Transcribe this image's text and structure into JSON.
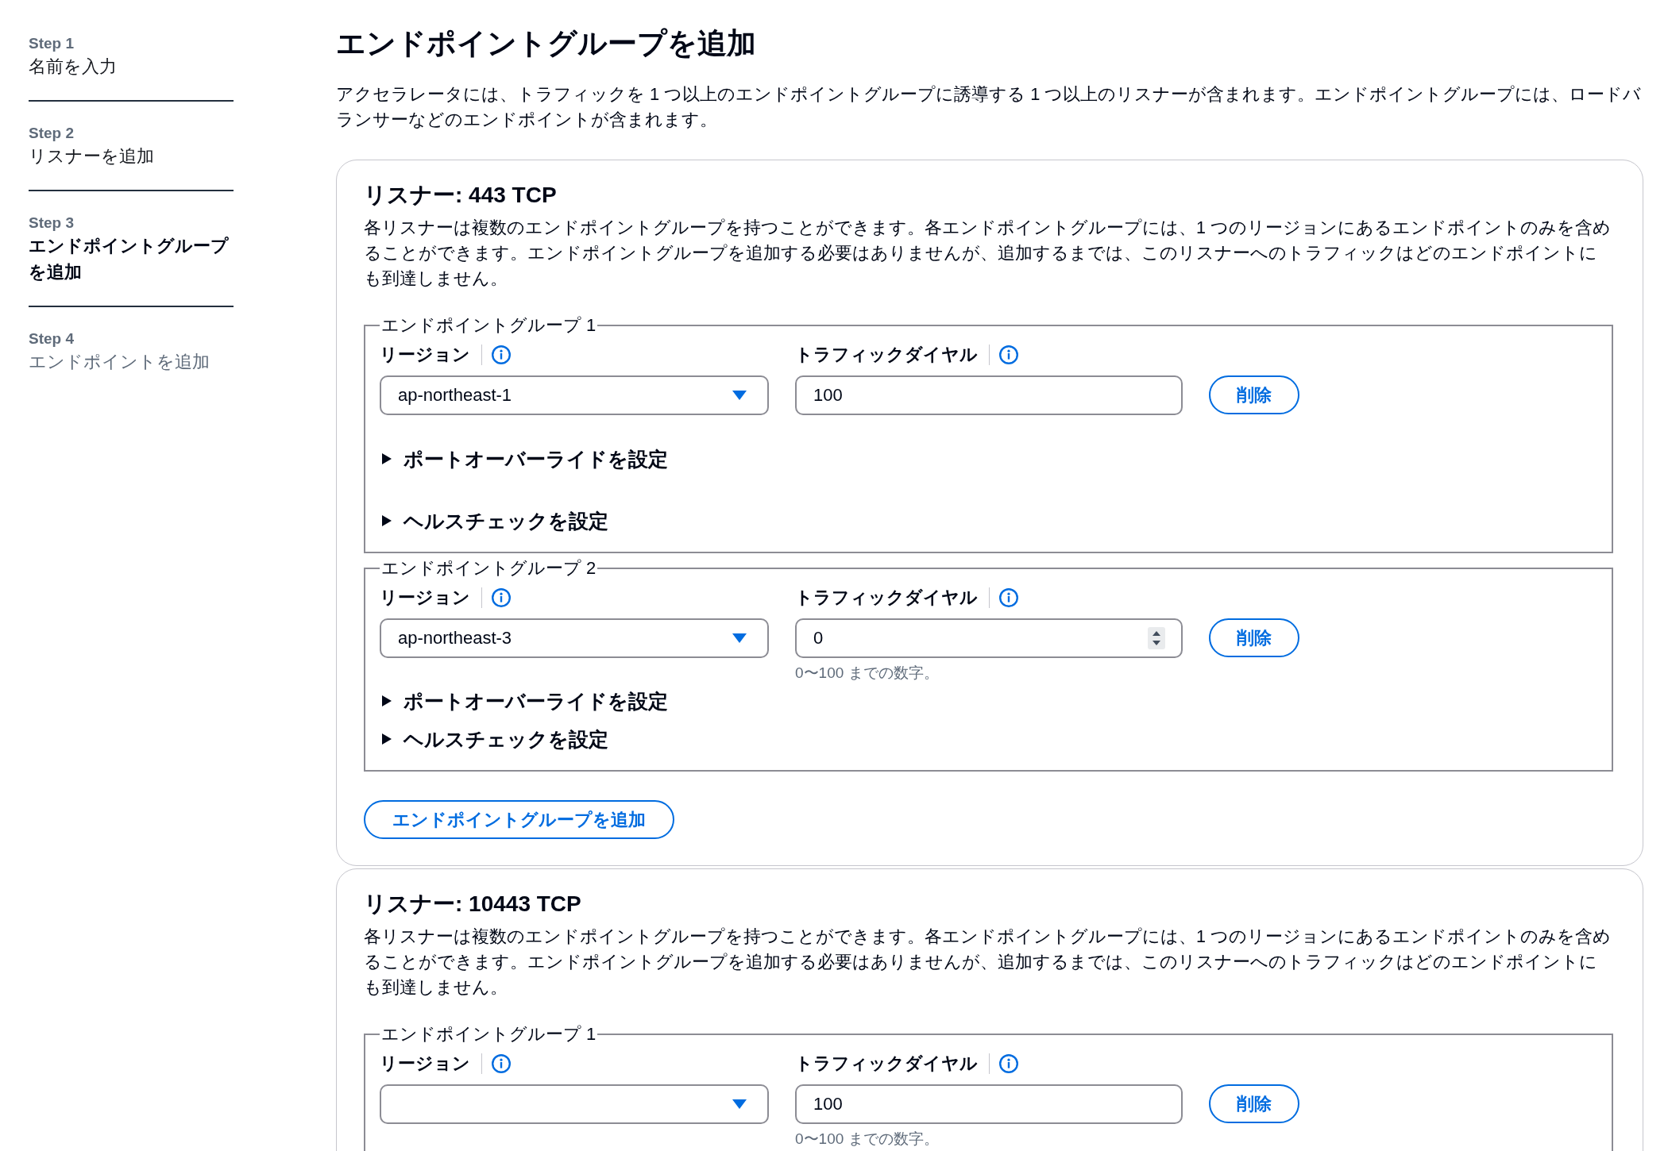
{
  "wizard_steps": [
    {
      "step": "Step 1",
      "label": "名前を入力",
      "selected": false,
      "disabled": false
    },
    {
      "step": "Step 2",
      "label": "リスナーを追加",
      "selected": false,
      "disabled": false
    },
    {
      "step": "Step 3",
      "label": "エンドポイントグループを追加",
      "selected": true,
      "disabled": false
    },
    {
      "step": "Step 4",
      "label": "エンドポイントを追加",
      "selected": false,
      "disabled": true
    }
  ],
  "page": {
    "title": "エンドポイントグループを追加",
    "description": "アクセラレータには、トラフィックを 1 つ以上のエンドポイントグループに誘導する 1 つ以上のリスナーが含まれます。エンドポイントグループには、ロードバランサーなどのエンドポイントが含まれます。"
  },
  "listeners": [
    {
      "title": "リスナー: 443 TCP",
      "description": "各リスナーは複数のエンドポイントグループを持つことができます。各エンドポイントグループには、1 つのリージョンにあるエンドポイントのみを含めることができます。エンドポイントグループを追加する必要はありませんが、追加するまでは、このリスナーへのトラフィックはどのエンドポイントにも到達しません。",
      "endpoint_groups": [
        {
          "legend": "エンドポイントグループ 1",
          "region": {
            "label": "リージョン",
            "value": "ap-northeast-1"
          },
          "traffic_dial": {
            "label": "トラフィックダイヤル",
            "value": "100",
            "spinner_visible": false
          },
          "remove_button": "削除",
          "expanders": [
            {
              "label": "ポートオーバーライドを設定",
              "expanded": false
            },
            {
              "label": "ヘルスチェックを設定",
              "expanded": false
            }
          ]
        },
        {
          "legend": "エンドポイントグループ 2",
          "region": {
            "label": "リージョン",
            "value": "ap-northeast-3"
          },
          "traffic_dial": {
            "label": "トラフィックダイヤル",
            "value": "0",
            "spinner_visible": true,
            "hint": "0〜100 までの数字。"
          },
          "remove_button": "削除",
          "expanders": [
            {
              "label": "ポートオーバーライドを設定",
              "expanded": false
            },
            {
              "label": "ヘルスチェックを設定",
              "expanded": false
            }
          ]
        }
      ],
      "add_button": "エンドポイントグループを追加"
    },
    {
      "title": "リスナー: 10443 TCP",
      "description": "各リスナーは複数のエンドポイントグループを持つことができます。各エンドポイントグループには、1 つのリージョンにあるエンドポイントのみを含めることができます。エンドポイントグループを追加する必要はありませんが、追加するまでは、このリスナーへのトラフィックはどのエンドポイントにも到達しません。",
      "endpoint_groups": [
        {
          "legend": "エンドポイントグループ 1",
          "region": {
            "label": "リージョン"
          },
          "traffic_dial": {
            "label": "トラフィックダイヤル",
            "value": "100",
            "spinner_visible": false,
            "hint": "0〜100 までの数字。"
          },
          "remove_button": "削除"
        }
      ]
    }
  ]
}
